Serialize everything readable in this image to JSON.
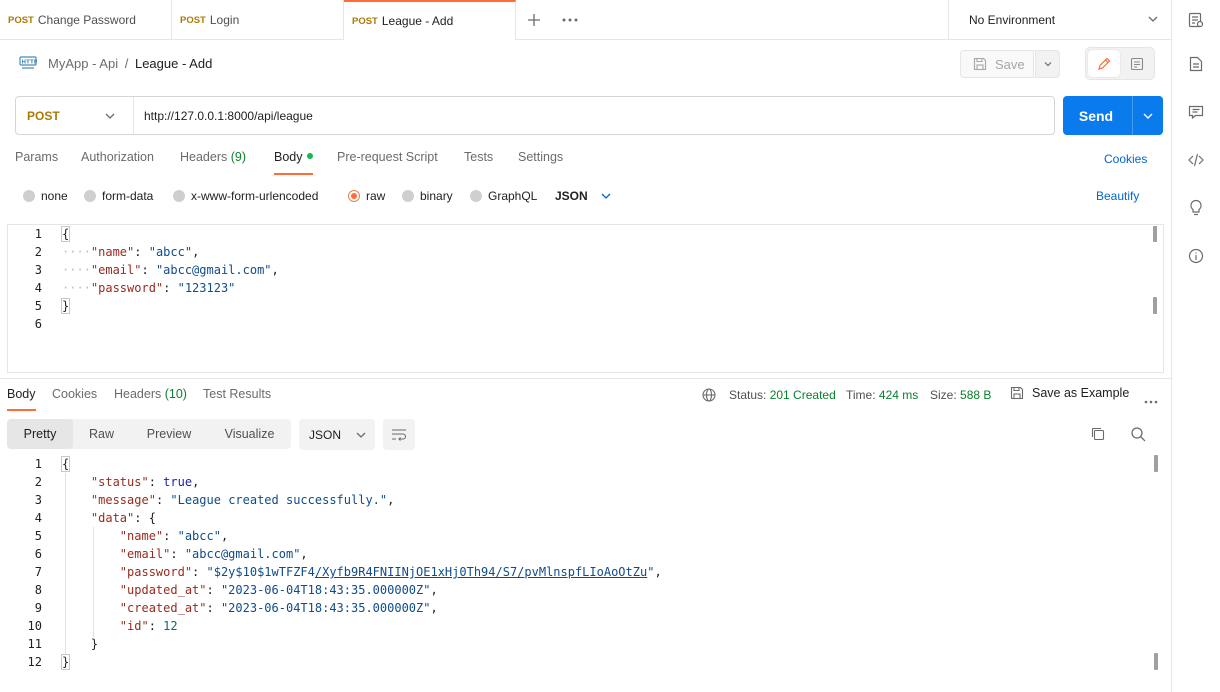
{
  "tabs": [
    {
      "method": "POST",
      "name": "Change Password",
      "active": false
    },
    {
      "method": "POST",
      "name": "Login",
      "active": false
    },
    {
      "method": "POST",
      "name": "League - Add",
      "active": true
    }
  ],
  "environment": {
    "selected": "No Environment"
  },
  "breadcrumb": {
    "collection": "MyApp - Api",
    "separator": "/",
    "request": "League - Add"
  },
  "toolbar": {
    "save_label": "Save"
  },
  "request": {
    "method": "POST",
    "url": "http://127.0.0.1:8000/api/league",
    "send_label": "Send"
  },
  "request_tabs": {
    "params": "Params",
    "authorization": "Authorization",
    "headers": "Headers",
    "headers_count": "(9)",
    "body": "Body",
    "prerequest": "Pre-request Script",
    "tests": "Tests",
    "settings": "Settings",
    "cookies": "Cookies"
  },
  "body_types": {
    "none": "none",
    "form_data": "form-data",
    "urlencoded": "x-www-form-urlencoded",
    "raw": "raw",
    "binary": "binary",
    "graphql": "GraphQL",
    "language": "JSON",
    "beautify": "Beautify",
    "selected": "raw"
  },
  "request_body": {
    "line_numbers": [
      "1",
      "2",
      "3",
      "4",
      "5",
      "6"
    ],
    "lines": [
      {
        "open": "{"
      },
      {
        "key": "\"name\"",
        "value": "\"abcc\"",
        "trail": ","
      },
      {
        "key": "\"email\"",
        "value": "\"abcc@gmail.com\"",
        "trail": ","
      },
      {
        "key": "\"password\"",
        "value": "\"123123\"",
        "trail": ""
      },
      {
        "close": "}"
      }
    ]
  },
  "response_tabs": {
    "body": "Body",
    "cookies": "Cookies",
    "headers": "Headers",
    "headers_count": "(10)",
    "test_results": "Test Results"
  },
  "response_status": {
    "status_label": "Status:",
    "status_value": "201 Created",
    "time_label": "Time:",
    "time_value": "424 ms",
    "size_label": "Size:",
    "size_value": "588 B",
    "save_example": "Save as Example"
  },
  "response_view": {
    "modes": [
      "Pretty",
      "Raw",
      "Preview",
      "Visualize"
    ],
    "selected_mode": "Pretty",
    "format": "JSON"
  },
  "response_body": {
    "line_numbers": [
      "1",
      "2",
      "3",
      "4",
      "5",
      "6",
      "7",
      "8",
      "9",
      "10",
      "11",
      "12"
    ],
    "open": "{",
    "status_key": "\"status\"",
    "status_value": "true",
    "message_key": "\"message\"",
    "message_value": "\"League created successfully.\"",
    "data_key": "\"data\"",
    "data_open": "{",
    "name_key": "\"name\"",
    "name_value": "\"abcc\"",
    "email_key": "\"email\"",
    "email_value": "\"abcc@gmail.com\"",
    "password_key": "\"password\"",
    "password_value_a": "\"$2y$10$1wTFZF4",
    "password_value_b": "/Xyfb9R4FNIINjOE1xHj0Th94/S7/pvMlnspfLIoAoOtZu",
    "password_value_c": "\"",
    "updated_key": "\"updated_at\"",
    "updated_value": "\"2023-06-04T18:43:35.000000Z\"",
    "created_key": "\"created_at\"",
    "created_value": "\"2023-06-04T18:43:35.000000Z\"",
    "id_key": "\"id\"",
    "id_value": "12",
    "data_close": "}",
    "close": "}"
  },
  "colors": {
    "accent": "#ff6c37",
    "send": "#097bed",
    "method_post": "#ad7a03",
    "status_ok": "#0a7f2f",
    "link": "#0265d2"
  }
}
